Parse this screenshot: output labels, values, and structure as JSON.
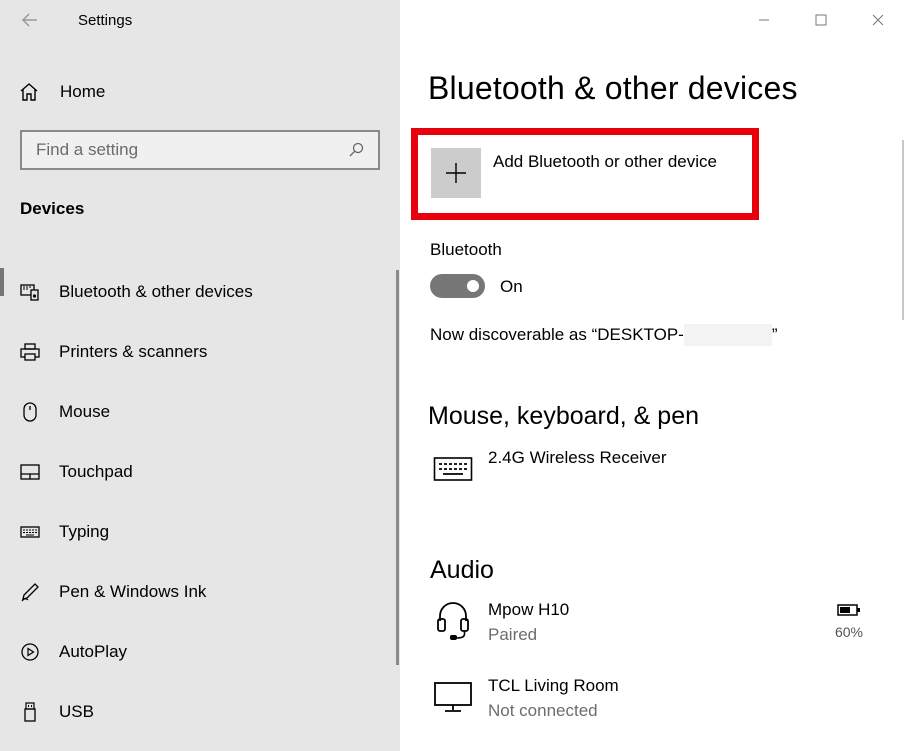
{
  "window": {
    "title": "Settings"
  },
  "sidebar": {
    "home_label": "Home",
    "search_placeholder": "Find a setting",
    "section_title": "Devices",
    "items": [
      {
        "label": "Bluetooth & other devices",
        "icon": "bluetooth-devices-icon"
      },
      {
        "label": "Printers & scanners",
        "icon": "printer-icon"
      },
      {
        "label": "Mouse",
        "icon": "mouse-icon"
      },
      {
        "label": "Touchpad",
        "icon": "touchpad-icon"
      },
      {
        "label": "Typing",
        "icon": "keyboard-icon"
      },
      {
        "label": "Pen & Windows Ink",
        "icon": "pen-icon"
      },
      {
        "label": "AutoPlay",
        "icon": "autoplay-icon"
      },
      {
        "label": "USB",
        "icon": "usb-icon"
      }
    ]
  },
  "main": {
    "title": "Bluetooth & other devices",
    "add_device_label": "Add Bluetooth or other device",
    "bluetooth": {
      "label": "Bluetooth",
      "state": "On",
      "discoverable_prefix": "Now discoverable as “DESKTOP-",
      "discoverable_suffix": "”"
    },
    "sections": {
      "mouse_keyboard_pen": {
        "title": "Mouse, keyboard, & pen",
        "devices": [
          {
            "name": "2.4G Wireless Receiver"
          }
        ]
      },
      "audio": {
        "title": "Audio",
        "devices": [
          {
            "name": "Mpow H10",
            "status": "Paired",
            "battery": "60%"
          },
          {
            "name": "TCL Living Room",
            "status": "Not connected"
          }
        ]
      }
    }
  },
  "colors": {
    "highlight": "#e8000c",
    "sidebar_bg": "#e6e6e6",
    "toggle_on": "#777777"
  }
}
